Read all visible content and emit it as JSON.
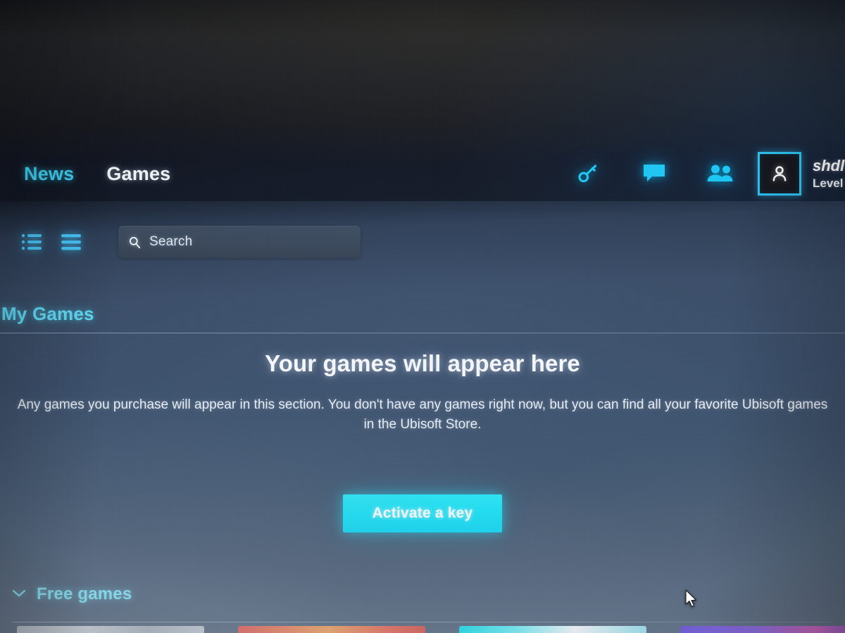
{
  "nav": {
    "items": [
      {
        "label": "News",
        "active": false
      },
      {
        "label": "Games",
        "active": true
      }
    ],
    "icons": [
      {
        "name": "key-icon",
        "label": "Activate key"
      },
      {
        "name": "chat-icon",
        "label": "Chat"
      },
      {
        "name": "friends-icon",
        "label": "Friends"
      }
    ]
  },
  "user": {
    "avatar_icon": "person-icon",
    "name": "shdl",
    "level": "Level"
  },
  "toolbar": {
    "view_grid_icon": "list-bullets-icon",
    "view_list_icon": "list-lines-icon",
    "search": {
      "icon": "search-icon",
      "placeholder": "Search",
      "value": ""
    }
  },
  "section": {
    "title": "My Games"
  },
  "empty_state": {
    "title": "Your games will appear here",
    "body": "Any games you purchase will appear in this section. You don't have any games right now, but you can find all your favorite Ubisoft games in the Ubisoft Store.",
    "cta_label": "Activate a key"
  },
  "free_games": {
    "chevron_icon": "chevron-down-icon",
    "label": "Free games"
  },
  "colors": {
    "accent_cyan": "#16e3f6",
    "link_cyan": "#5fe0fb",
    "nav_active": "#f2f5f8",
    "panel_blue": "#3c506c",
    "chrome_dark": "#1d1f24"
  }
}
